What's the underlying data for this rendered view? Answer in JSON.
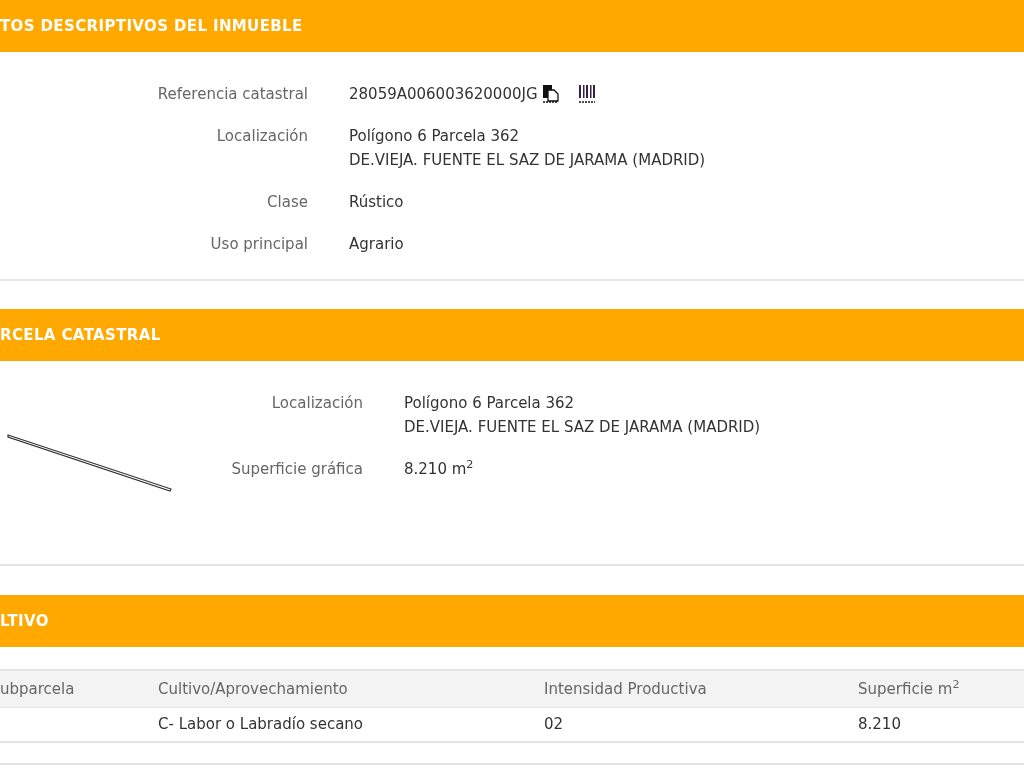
{
  "sections": [
    {
      "title": "TOS DESCRIPTIVOS DEL INMUEBLE",
      "kind": "fields",
      "fields": [
        {
          "label": "Referencia catastral",
          "lines": [
            "28059A006003620000JG"
          ],
          "kind": "reference"
        },
        {
          "label": "Localización",
          "lines": [
            "Polígono 6 Parcela 362",
            "DE.VIEJA. FUENTE EL SAZ DE JARAMA (MADRID)"
          ],
          "kind": "text"
        },
        {
          "label": "Clase",
          "lines": [
            "Rústico"
          ],
          "kind": "text"
        },
        {
          "label": "Uso principal",
          "lines": [
            "Agrario"
          ],
          "kind": "text"
        }
      ]
    },
    {
      "title": "RCELA CATASTRAL",
      "kind": "parcel",
      "fields": [
        {
          "label": "Localización",
          "lines": [
            "Polígono 6 Parcela 362",
            "DE.VIEJA. FUENTE EL SAZ DE JARAMA (MADRID)"
          ],
          "kind": "text"
        },
        {
          "label": "Superficie gráfica",
          "lines": [
            "8.210 m$^{2}$"
          ],
          "kind": "text"
        }
      ]
    },
    {
      "title": "LTIVO",
      "kind": "table",
      "table": {
        "columns": [
          "ubparcela",
          "Cultivo/Aprovechamiento",
          "Intensidad Productiva",
          "Superficie m$^{2}$"
        ],
        "rows": [
          [
            "",
            "C- Labor o Labradío secano",
            "02",
            "8.210"
          ]
        ]
      }
    }
  ]
}
